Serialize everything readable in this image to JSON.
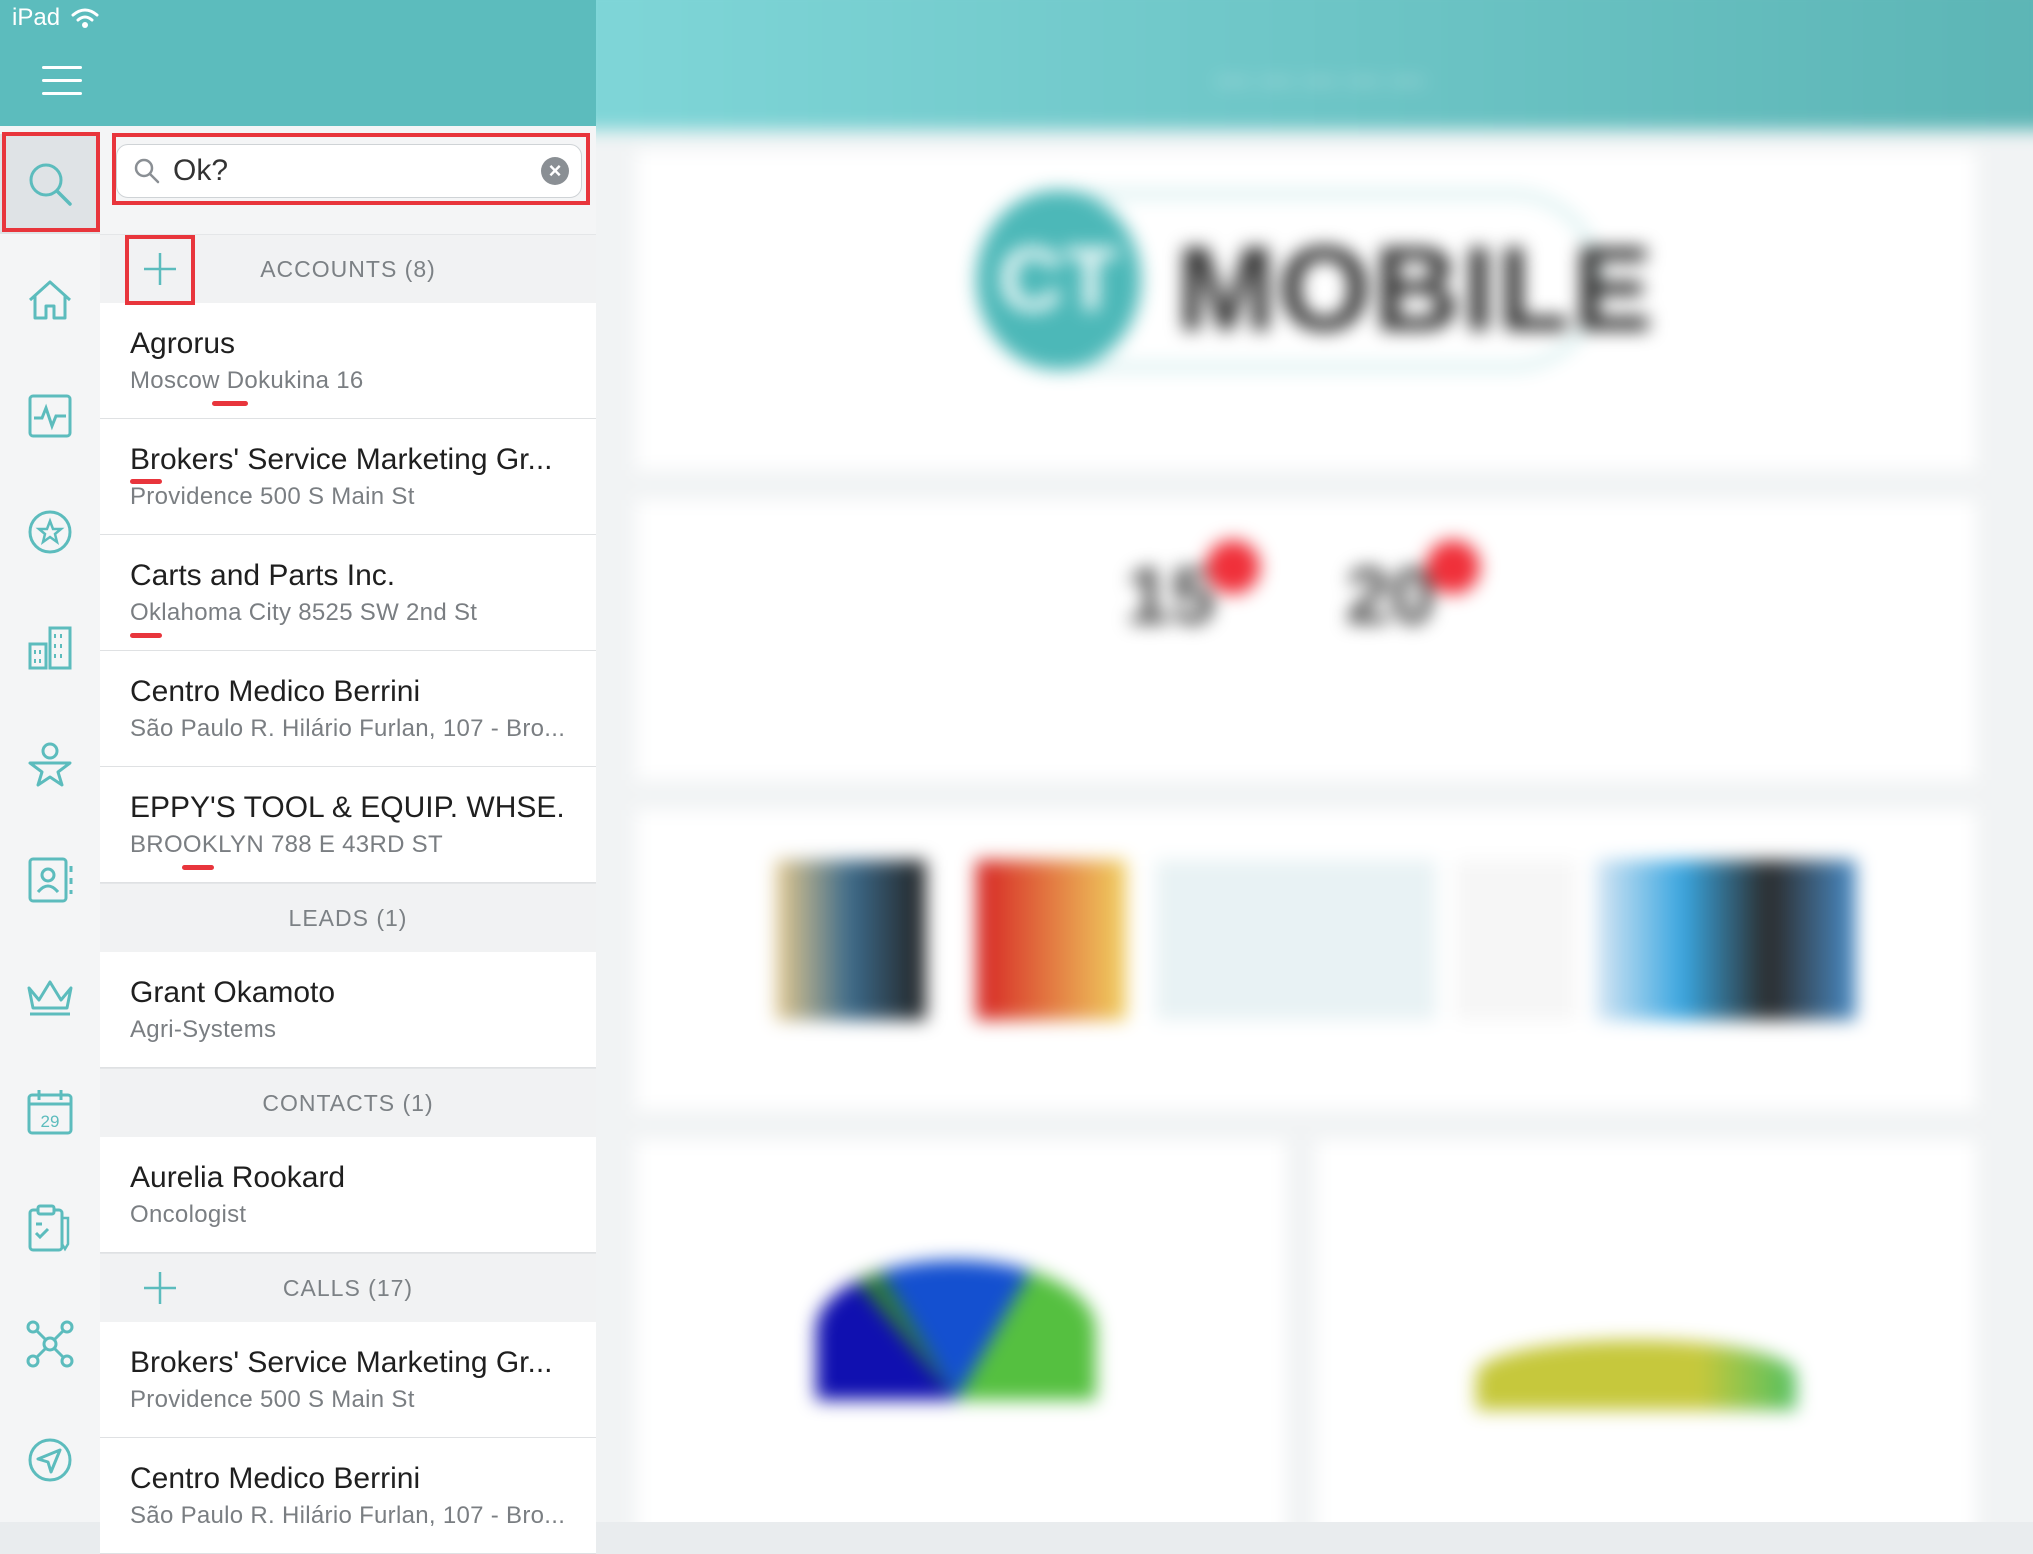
{
  "status_bar": {
    "device": "iPad"
  },
  "search": {
    "value": "Ok?",
    "clear_label": "×"
  },
  "sections": [
    {
      "label": "ACCOUNTS (8)",
      "has_add": true,
      "items": [
        {
          "title": "Agrorus",
          "subtitle": "Moscow Dokukina 16"
        },
        {
          "title": "Brokers' Service Marketing Gr...",
          "subtitle": "Providence 500 S Main St"
        },
        {
          "title": "Carts and Parts Inc.",
          "subtitle": "Oklahoma City 8525 SW 2nd St"
        },
        {
          "title": "Centro Medico Berrini",
          "subtitle": "São Paulo R. Hilário Furlan, 107 - Bro..."
        },
        {
          "title": "EPPY'S TOOL & EQUIP. WHSE.",
          "subtitle": "BROOKLYN 788 E 43RD ST"
        }
      ]
    },
    {
      "label": "LEADS (1)",
      "has_add": false,
      "items": [
        {
          "title": "Grant Okamoto",
          "subtitle": "Agri-Systems"
        }
      ]
    },
    {
      "label": "CONTACTS (1)",
      "has_add": false,
      "items": [
        {
          "title": "Aurelia Rookard",
          "subtitle": "Oncologist"
        }
      ]
    },
    {
      "label": "CALLS (17)",
      "has_add": true,
      "items": [
        {
          "title": "Brokers' Service Marketing Gr...",
          "subtitle": "Providence 500 S Main St"
        },
        {
          "title": "Centro Medico Berrini",
          "subtitle": "São Paulo R. Hilário Furlan, 107 - Bro..."
        }
      ]
    }
  ],
  "rail_icons": [
    "search-icon",
    "home-icon",
    "activity-icon",
    "favorites-icon",
    "buildings-icon",
    "person-star-icon",
    "contacts-book-icon",
    "crown-icon",
    "calendar-icon",
    "checklist-icon",
    "network-icon",
    "navigation-icon"
  ],
  "calendar_day": "29",
  "dashboard": {
    "logo_short": "CT",
    "logo_word": "MOBILE",
    "kpi_a": "15",
    "kpi_b": "20"
  },
  "colors": {
    "accent": "#5cbcbd",
    "highlight": "#e8353c"
  }
}
